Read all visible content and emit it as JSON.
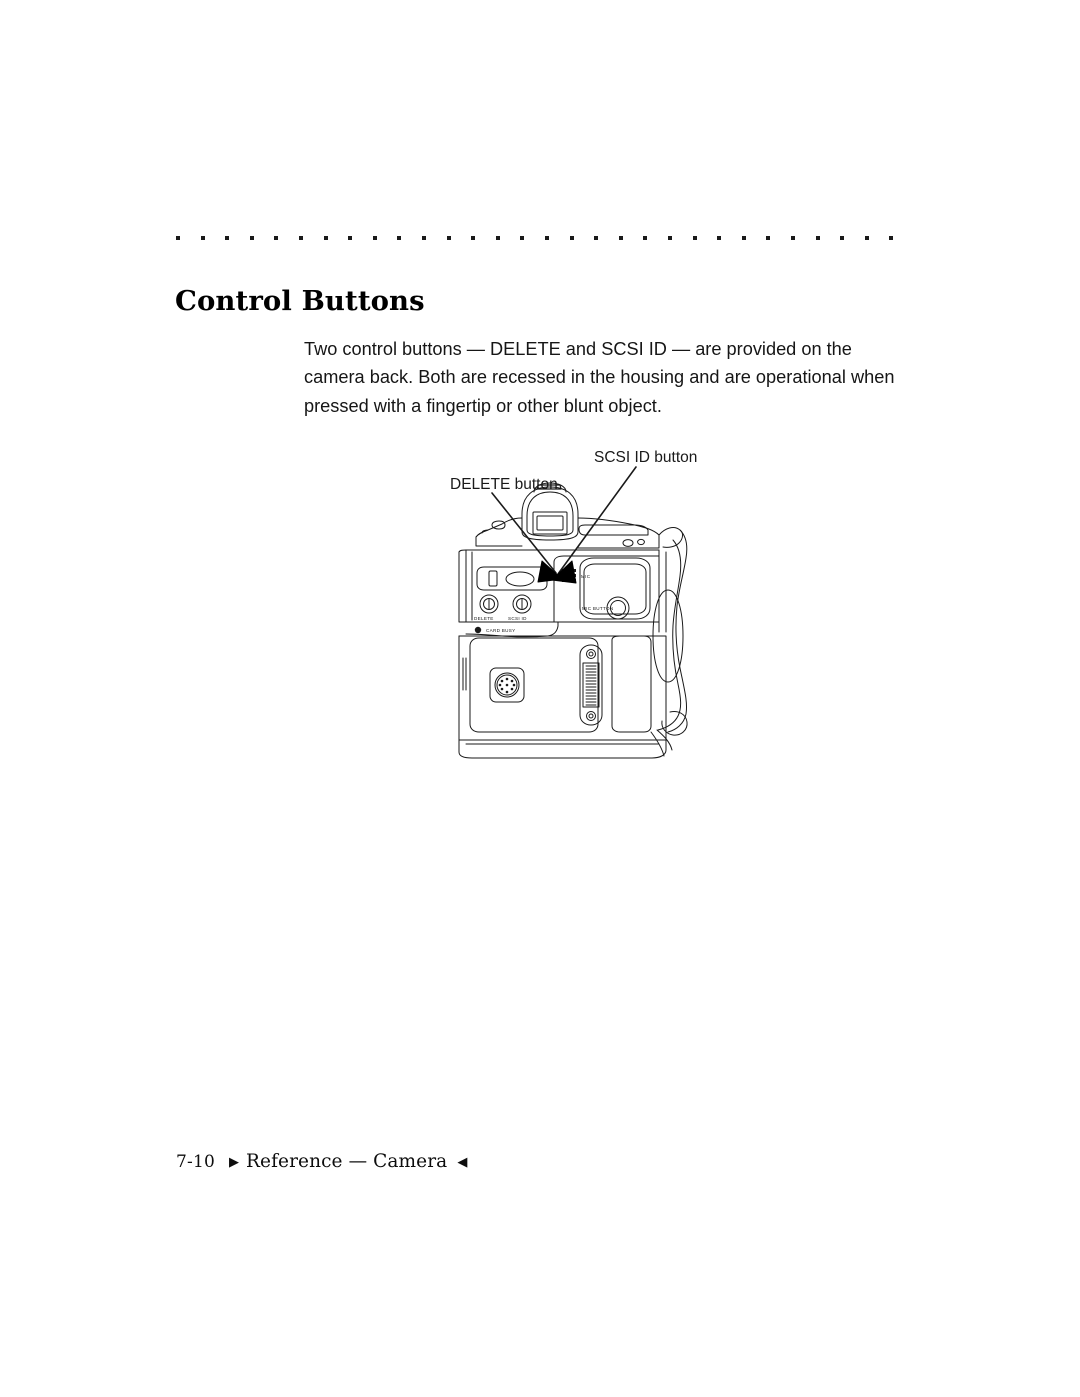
{
  "document": {
    "type": "manual-page",
    "page_background": "#ffffff",
    "text_color": "#000000"
  },
  "rule": {
    "name": "dotted-rule",
    "dot_count": 30,
    "dot_spacing_px": 24.6,
    "dot_size_px": 4,
    "color": "#1a1a1a"
  },
  "heading": {
    "title": "Control Buttons"
  },
  "body": {
    "paragraph": "Two control buttons — DELETE and SCSI ID — are provided on the camera back. Both are recessed in the housing and are operational when pressed with a fingertip or other blunt object."
  },
  "figure": {
    "caption_labels": {
      "delete": "DELETE button",
      "scsi": "SCSI ID button"
    },
    "camera_panel_labels": {
      "delete": "DELETE",
      "scsi_id": "SCSI ID",
      "card_busy": "CARD BUSY",
      "mic": "MIC",
      "mic_button": "MIC BUTTON"
    }
  },
  "footer": {
    "page_number": "7-10",
    "marker_left": "▶",
    "breadcrumb": "Reference — Camera",
    "marker_right": "◀"
  }
}
